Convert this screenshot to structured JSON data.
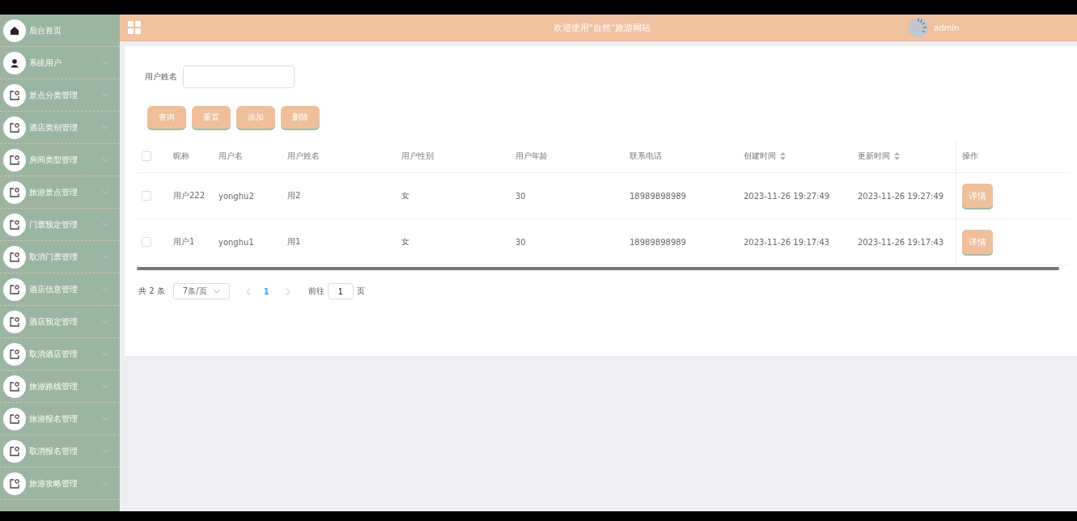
{
  "sidebar": {
    "items": [
      {
        "label": "后台首页",
        "kind": "home",
        "expandable": false
      },
      {
        "label": "系统用户",
        "kind": "user",
        "expandable": true
      },
      {
        "label": "景点分类管理",
        "kind": "module",
        "expandable": true
      },
      {
        "label": "酒店类别管理",
        "kind": "module",
        "expandable": true
      },
      {
        "label": "房间类型管理",
        "kind": "module",
        "expandable": true
      },
      {
        "label": "旅游景点管理",
        "kind": "module",
        "expandable": true
      },
      {
        "label": "门票预定管理",
        "kind": "module",
        "expandable": true
      },
      {
        "label": "取消门票管理",
        "kind": "module",
        "expandable": true
      },
      {
        "label": "酒店信息管理",
        "kind": "module",
        "expandable": true
      },
      {
        "label": "酒店预定管理",
        "kind": "module",
        "expandable": true
      },
      {
        "label": "取消酒店管理",
        "kind": "module",
        "expandable": true
      },
      {
        "label": "旅游路线管理",
        "kind": "module",
        "expandable": true
      },
      {
        "label": "旅游报名管理",
        "kind": "module",
        "expandable": true
      },
      {
        "label": "取消报名管理",
        "kind": "module",
        "expandable": true
      },
      {
        "label": "旅游攻略管理",
        "kind": "module",
        "expandable": true
      }
    ]
  },
  "header": {
    "title": "欢迎使用\"自然\"旅游网站",
    "user": "admin"
  },
  "search": {
    "label": "用户姓名"
  },
  "buttons": [
    "查询",
    "重置",
    "添加",
    "删除"
  ],
  "table": {
    "all_checked": false,
    "columns": [
      {
        "label": "昵称",
        "sortable": false
      },
      {
        "label": "用户名",
        "sortable": false
      },
      {
        "label": "用户姓名",
        "sortable": false
      },
      {
        "label": "用户性别",
        "sortable": false
      },
      {
        "label": "用户年龄",
        "sortable": false
      },
      {
        "label": "联系电话",
        "sortable": false
      },
      {
        "label": "创建时间",
        "sortable": true
      },
      {
        "label": "更新时间",
        "sortable": true
      },
      {
        "label": "操作",
        "sortable": false
      }
    ],
    "rows": [
      {
        "checked": false,
        "cells": [
          "用户222",
          "yonghu2",
          "用2",
          "女",
          "30",
          "18989898989",
          "2023-11-26 19:27:49",
          "2023-11-26 19:27:49"
        ],
        "action": "详情"
      },
      {
        "checked": false,
        "cells": [
          "用户1",
          "yonghu1",
          "用1",
          "女",
          "30",
          "18989898989",
          "2023-11-26 19:17:43",
          "2023-11-26 19:17:43"
        ],
        "action": "详情"
      }
    ]
  },
  "pagination": {
    "total": "共 2 条",
    "page_size": "7条/页",
    "pages": [
      {
        "label": "1",
        "selected": true
      }
    ],
    "goto_label": "前往",
    "goto_value": "1",
    "goto_suffix": "页"
  }
}
